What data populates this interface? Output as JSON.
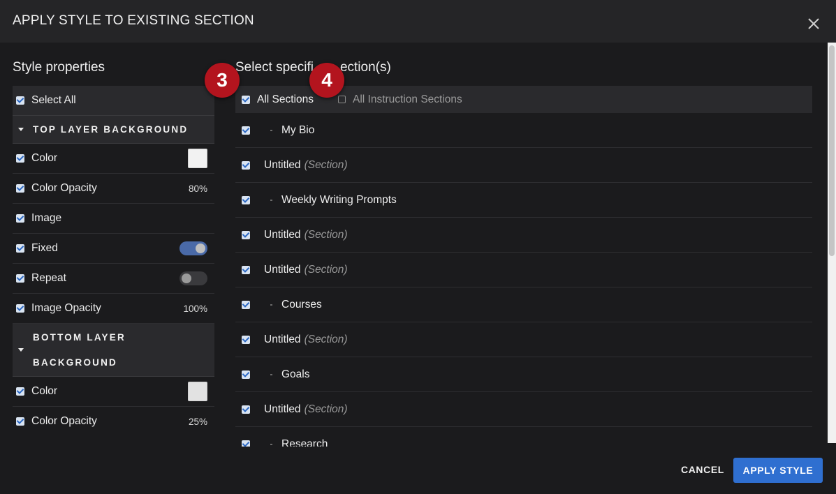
{
  "header": {
    "title": "APPLY STYLE TO EXISTING SECTION",
    "close_icon": "close-icon"
  },
  "style_properties": {
    "title": "Style properties",
    "select_all": "Select All",
    "top_layer": {
      "heading": "TOP LAYER BACKGROUND",
      "color": "Color",
      "color_value": "#f2f2f2",
      "color_opacity": "Color Opacity",
      "color_opacity_value": "80%",
      "image": "Image",
      "fixed": "Fixed",
      "fixed_on": true,
      "repeat": "Repeat",
      "repeat_on": false,
      "image_opacity": "Image Opacity",
      "image_opacity_value": "100%"
    },
    "bottom_layer": {
      "heading_line1": "BOTTOM LAYER",
      "heading_line2": "BACKGROUND",
      "color": "Color",
      "color_value": "#e2e2e2",
      "color_opacity": "Color Opacity",
      "color_opacity_value": "25%"
    }
  },
  "sections": {
    "title_part1": "Select specifi",
    "title_part2": "ection(s)",
    "all_sections": "All Sections",
    "all_instruction_sections": "All Instruction Sections",
    "items": [
      {
        "name": "My Bio",
        "sub": "",
        "bullet": true
      },
      {
        "name": "Untitled",
        "sub": "(Section)",
        "bullet": false
      },
      {
        "name": "Weekly Writing Prompts",
        "sub": "",
        "bullet": true
      },
      {
        "name": "Untitled",
        "sub": "(Section)",
        "bullet": false
      },
      {
        "name": "Untitled",
        "sub": "(Section)",
        "bullet": false
      },
      {
        "name": "Courses",
        "sub": "",
        "bullet": true
      },
      {
        "name": "Untitled",
        "sub": "(Section)",
        "bullet": false
      },
      {
        "name": "Goals",
        "sub": "",
        "bullet": true
      },
      {
        "name": "Untitled",
        "sub": "(Section)",
        "bullet": false
      },
      {
        "name": "Research",
        "sub": "",
        "bullet": true
      }
    ]
  },
  "footer": {
    "cancel": "CANCEL",
    "apply": "APPLY STYLE"
  },
  "badges": {
    "b3": "3",
    "b4": "4"
  },
  "colors": {
    "accent": "#2f6fd0",
    "badge": "#b3141e",
    "background": "#1b1b1d"
  }
}
